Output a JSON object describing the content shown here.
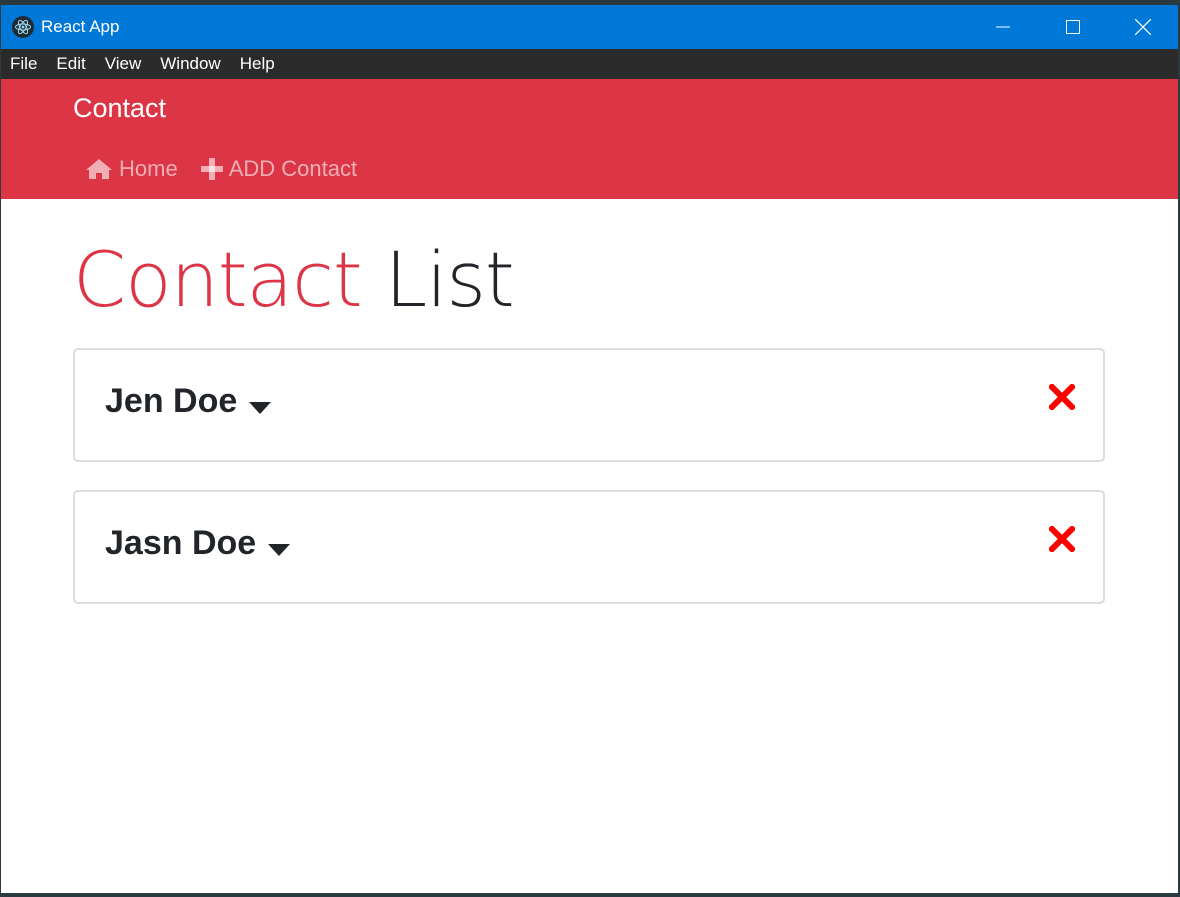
{
  "window": {
    "title": "React App",
    "icon": "electron-icon"
  },
  "menu": [
    "File",
    "Edit",
    "View",
    "Window",
    "Help"
  ],
  "navbar": {
    "brand": "Contact",
    "links": [
      {
        "label": "Home",
        "icon": "home-icon"
      },
      {
        "label": "ADD Contact",
        "icon": "plus-icon"
      }
    ],
    "color": "#dc3545"
  },
  "page": {
    "heading_accent": "Contact",
    "heading_rest": "List"
  },
  "contacts": [
    {
      "name": "Jen Doe"
    },
    {
      "name": "Jasn Doe"
    }
  ],
  "colors": {
    "accent": "#dc3545",
    "delete": "#ff0000",
    "titlebar": "#0078d7"
  }
}
